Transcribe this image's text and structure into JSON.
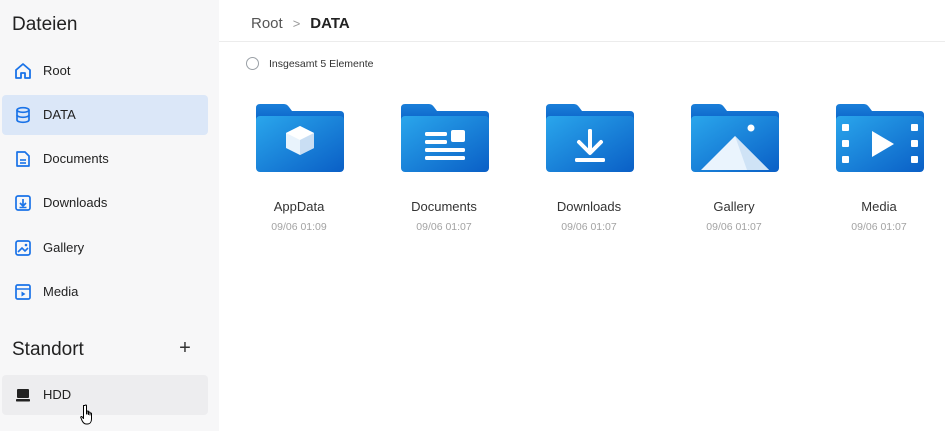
{
  "sidebar": {
    "files_heading": "Dateien",
    "items": [
      {
        "label": "Root",
        "icon": "home-icon",
        "active": false
      },
      {
        "label": "DATA",
        "icon": "database-icon",
        "active": true
      },
      {
        "label": "Documents",
        "icon": "document-icon",
        "active": false
      },
      {
        "label": "Downloads",
        "icon": "download-icon",
        "active": false
      },
      {
        "label": "Gallery",
        "icon": "image-icon",
        "active": false
      },
      {
        "label": "Media",
        "icon": "video-icon",
        "active": false
      }
    ],
    "location_heading": "Standort",
    "add_label": "+",
    "locations": [
      {
        "label": "HDD",
        "icon": "hard-drive-icon"
      }
    ]
  },
  "breadcrumb": {
    "root": "Root",
    "separator": ">",
    "current": "DATA"
  },
  "toolbar": {
    "count_text": "Insgesamt 5 Elemente"
  },
  "folders": [
    {
      "name": "AppData",
      "date": "09/06 01:09",
      "icon": "cube-folder-icon"
    },
    {
      "name": "Documents",
      "date": "09/06 01:07",
      "icon": "document-folder-icon"
    },
    {
      "name": "Downloads",
      "date": "09/06 01:07",
      "icon": "download-folder-icon"
    },
    {
      "name": "Gallery",
      "date": "09/06 01:07",
      "icon": "image-folder-icon"
    },
    {
      "name": "Media",
      "date": "09/06 01:07",
      "icon": "video-folder-icon"
    }
  ],
  "colors": {
    "accent": "#1677d8",
    "folder_light": "#29a0e6",
    "folder_dark": "#0b63c9",
    "active_bg": "#dbe7f8"
  }
}
